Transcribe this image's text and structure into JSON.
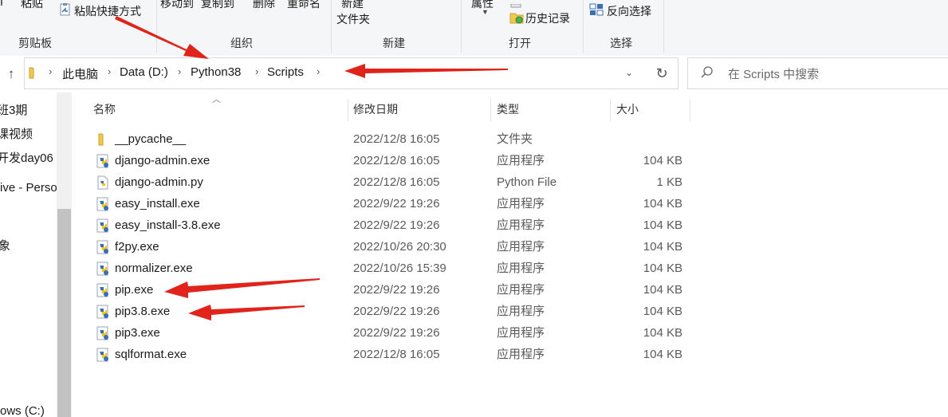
{
  "ribbon": {
    "paste": "粘贴",
    "paste_shortcut": "粘贴快捷方式",
    "move_to": "移动到",
    "copy_to": "复制到",
    "delete": "删除",
    "rename": "重命名",
    "new_folder_line1": "新建",
    "new_folder_line2": "文件夹",
    "properties": "属性",
    "history": "历史记录",
    "invert_select": "反向选择",
    "groups": {
      "clipboard": "剪贴板",
      "organize": "组织",
      "new": "新建",
      "open": "打开",
      "select": "选择"
    }
  },
  "address": {
    "crumbs": [
      "此电脑",
      "Data (D:)",
      "Python38",
      "Scripts"
    ]
  },
  "search": {
    "placeholder": "在 Scripts 中搜索"
  },
  "sidebar": {
    "items": [
      "班3期",
      "课视频",
      "开发day06",
      "ive - Perso",
      "象",
      "ows (C:)"
    ]
  },
  "columns": {
    "name": "名称",
    "date": "修改日期",
    "type": "类型",
    "size": "大小"
  },
  "files": [
    {
      "name": "__pycache__",
      "date": "2022/12/8 16:05",
      "type": "文件夹",
      "size": "",
      "icon": "folder-icon"
    },
    {
      "name": "django-admin.exe",
      "date": "2022/12/8 16:05",
      "type": "应用程序",
      "size": "104 KB",
      "icon": "python-exe-icon"
    },
    {
      "name": "django-admin.py",
      "date": "2022/12/8 16:05",
      "type": "Python File",
      "size": "1 KB",
      "icon": "python-file-icon"
    },
    {
      "name": "easy_install.exe",
      "date": "2022/9/22 19:26",
      "type": "应用程序",
      "size": "104 KB",
      "icon": "python-exe-icon"
    },
    {
      "name": "easy_install-3.8.exe",
      "date": "2022/9/22 19:26",
      "type": "应用程序",
      "size": "104 KB",
      "icon": "python-exe-icon"
    },
    {
      "name": "f2py.exe",
      "date": "2022/10/26 20:30",
      "type": "应用程序",
      "size": "104 KB",
      "icon": "python-exe-icon"
    },
    {
      "name": "normalizer.exe",
      "date": "2022/10/26 15:39",
      "type": "应用程序",
      "size": "104 KB",
      "icon": "python-exe-icon"
    },
    {
      "name": "pip.exe",
      "date": "2022/9/22 19:26",
      "type": "应用程序",
      "size": "104 KB",
      "icon": "python-exe-icon"
    },
    {
      "name": "pip3.8.exe",
      "date": "2022/9/22 19:26",
      "type": "应用程序",
      "size": "104 KB",
      "icon": "python-exe-icon"
    },
    {
      "name": "pip3.exe",
      "date": "2022/9/22 19:26",
      "type": "应用程序",
      "size": "104 KB",
      "icon": "python-exe-icon"
    },
    {
      "name": "sqlformat.exe",
      "date": "2022/12/8 16:05",
      "type": "应用程序",
      "size": "104 KB",
      "icon": "python-exe-icon"
    }
  ],
  "colors": {
    "annotation_arrow": "#e0241c",
    "folder": "#f2c94c",
    "python_blue": "#3b6fb5",
    "python_yellow": "#f5c518"
  }
}
